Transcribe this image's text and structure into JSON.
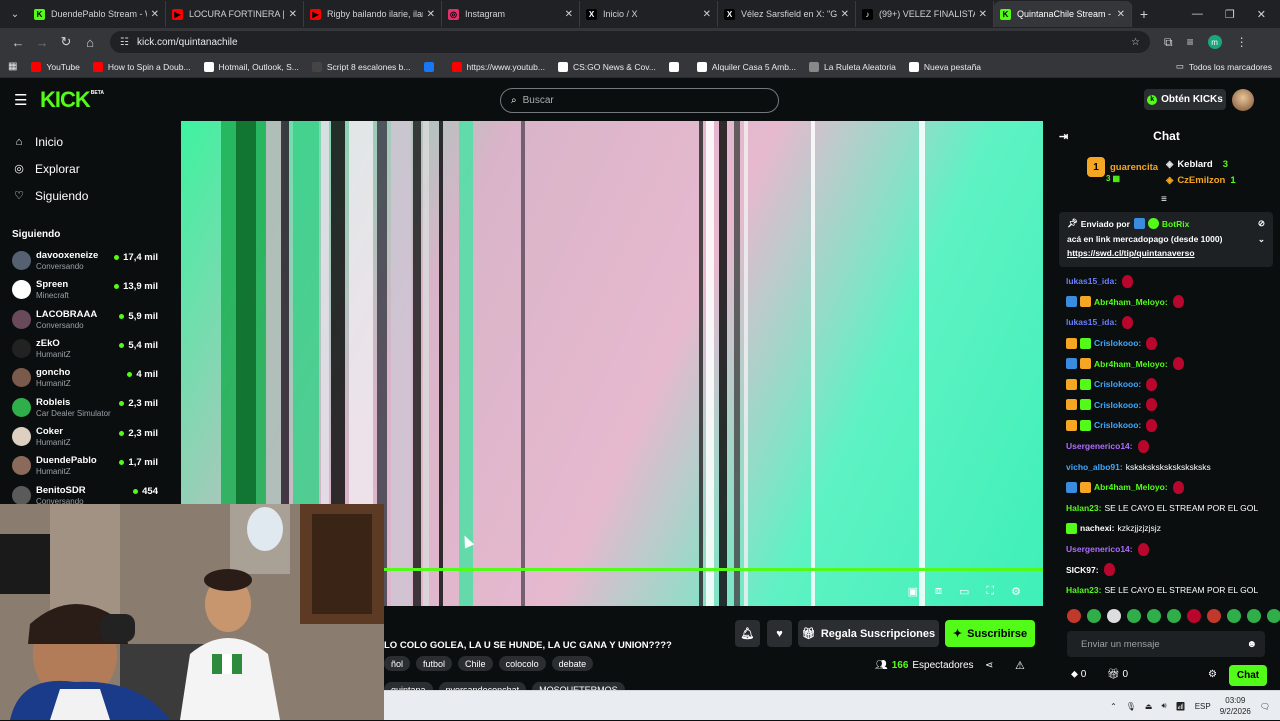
{
  "browser": {
    "tabs": [
      {
        "label": "DuendePablo Stream - W",
        "color": "#53fc18",
        "glyph": "K"
      },
      {
        "label": "LOCURA FORTINERA | VÉL",
        "color": "#ff0000",
        "glyph": "▶"
      },
      {
        "label": "Rigby bailando ilarie, ilari",
        "color": "#ff0000",
        "glyph": "▶"
      },
      {
        "label": "Instagram",
        "color": "#e1306c",
        "glyph": "◎"
      },
      {
        "label": "Inicio / X",
        "color": "#000000",
        "glyph": "X"
      },
      {
        "label": "Vélez Sarsfield en X: \"Gui",
        "color": "#000000",
        "glyph": "X"
      },
      {
        "label": "(99+) VELEZ FINALISTA V",
        "color": "#000000",
        "glyph": "♪"
      },
      {
        "label": "QuintanaChile Stream - W",
        "color": "#53fc18",
        "glyph": "K"
      }
    ],
    "url": "kick.com/quintanachile",
    "bookmarks": [
      {
        "label": "YouTube",
        "color": "#ff0000"
      },
      {
        "label": "How to Spin a Doub...",
        "color": "#ff0000"
      },
      {
        "label": "Hotmail, Outlook, S...",
        "color": "#ffffff"
      },
      {
        "label": "Script 8 escalones b...",
        "color": "#444444"
      },
      {
        "label": "",
        "color": "#1877f2"
      },
      {
        "label": "https://www.youtub...",
        "color": "#ff0000"
      },
      {
        "label": "CS:GO News & Cov...",
        "color": "#ffffff"
      },
      {
        "label": "",
        "color": "#ffffff"
      },
      {
        "label": "Alquiler Casa 5 Amb...",
        "color": "#ffffff"
      },
      {
        "label": "La Ruleta Aleatoria",
        "color": "#888888"
      },
      {
        "label": "Nueva pestaña",
        "color": "#ffffff"
      }
    ],
    "all_bookmarks": "Todos los marcadores"
  },
  "kick": {
    "logo": "KICK",
    "logo_sup": "BETA",
    "search_placeholder": "Buscar",
    "kicks_button": "Obtén KICKs",
    "accent": "#53fc18"
  },
  "sidebar": {
    "nav": [
      {
        "label": "Inicio",
        "icon": "home-icon"
      },
      {
        "label": "Explorar",
        "icon": "compass-icon"
      },
      {
        "label": "Siguiendo",
        "icon": "heart-icon"
      }
    ],
    "section_title": "Siguiendo",
    "following": [
      {
        "name": "davooxeneize",
        "game": "Conversando",
        "viewers": "17,4 mil",
        "avatar": "#556070"
      },
      {
        "name": "Spreen",
        "game": "Minecraft",
        "viewers": "13,9 mil",
        "avatar": "#ffffff"
      },
      {
        "name": "LACOBRAAA",
        "game": "Conversando",
        "viewers": "5,9 mil",
        "avatar": "#6a4a5a"
      },
      {
        "name": "zEkO",
        "game": "HumanitZ",
        "viewers": "5,4 mil",
        "avatar": "#222222"
      },
      {
        "name": "goncho",
        "game": "HumanitZ",
        "viewers": "4 mil",
        "avatar": "#7a5a4a"
      },
      {
        "name": "Robleis",
        "game": "Car Dealer Simulator",
        "viewers": "2,3 mil",
        "avatar": "#2fae4a"
      },
      {
        "name": "Coker",
        "game": "HumanitZ",
        "viewers": "2,3 mil",
        "avatar": "#ddd0c0"
      },
      {
        "name": "DuendePablo",
        "game": "HumanitZ",
        "viewers": "1,7 mil",
        "avatar": "#8a6a5a"
      },
      {
        "name": "BenitoSDR",
        "game": "Conversando",
        "viewers": "454",
        "avatar": "#5a5a5a"
      }
    ]
  },
  "stream": {
    "title": "LO COLO GOLEA, LA U SE HUNDE, LA UC GANA Y UNION????",
    "tags": [
      "ñol",
      "futbol",
      "Chile",
      "colocolo",
      "debate",
      "quintana",
      "nversandoconchat",
      "MOSQUETERMOS"
    ],
    "gift_button": "Regala Suscripciones",
    "subscribe_button": "Suscribirse",
    "viewers_count": "166",
    "viewers_label": "Espectadores",
    "progress": 0.23
  },
  "chat": {
    "title": "Chat",
    "leaderboard": [
      {
        "rank": "1",
        "name": "guarencita",
        "count": "3",
        "color": "#f5a623"
      },
      {
        "name": "Keblard",
        "count": "3",
        "color": "#ffffff"
      },
      {
        "name": "CzEmilzon",
        "count": "1",
        "color": "#f5a623"
      }
    ],
    "pinned_by": "Enviado por",
    "pinned_user": "BotRix",
    "pinned_text": "acá en link mercadopago (desde 1000)",
    "pinned_link": "https://swd.cl/tip/quintanaverso",
    "messages": [
      {
        "user": "lukas15_ida",
        "color": "#6b7fff",
        "text": "",
        "emote": true,
        "badges": []
      },
      {
        "user": "Abr4ham_Meloyo",
        "color": "#53fc18",
        "text": "",
        "emote": true,
        "badges": [
          "#3a8dde",
          "#f5a623"
        ]
      },
      {
        "user": "lukas15_ida",
        "color": "#6b7fff",
        "text": "",
        "emote": true,
        "badges": []
      },
      {
        "user": "Crislokooo",
        "color": "#3fa9ff",
        "text": "",
        "emote": true,
        "badges": [
          "#f5a623",
          "#53fc18"
        ]
      },
      {
        "user": "Abr4ham_Meloyo",
        "color": "#53fc18",
        "text": "",
        "emote": true,
        "badges": [
          "#3a8dde",
          "#f5a623"
        ]
      },
      {
        "user": "Crislokooo",
        "color": "#3fa9ff",
        "text": "",
        "emote": true,
        "badges": [
          "#f5a623",
          "#53fc18"
        ]
      },
      {
        "user": "Crislokooo",
        "color": "#3fa9ff",
        "text": "",
        "emote": true,
        "badges": [
          "#f5a623",
          "#53fc18"
        ]
      },
      {
        "user": "Crislokooo",
        "color": "#3fa9ff",
        "text": "",
        "emote": true,
        "badges": [
          "#f5a623",
          "#53fc18"
        ]
      },
      {
        "user": "Usergenerico14",
        "color": "#b06bff",
        "text": "",
        "emote": true,
        "badges": []
      },
      {
        "user": "vicho_albo91",
        "color": "#3fa9ff",
        "text": "ksksksksksksksksksks",
        "emote": false,
        "badges": []
      },
      {
        "user": "Abr4ham_Meloyo",
        "color": "#53fc18",
        "text": "",
        "emote": true,
        "badges": [
          "#3a8dde",
          "#f5a623"
        ]
      },
      {
        "user": "Halan23",
        "color": "#53fc18",
        "text": "SE LE CAYO EL STREAM POR EL GOL",
        "emote": false,
        "badges": []
      },
      {
        "user": "nachexi",
        "color": "#ffffff",
        "text": "kzkzjjzjzjsjz",
        "emote": false,
        "badges": [
          "#53fc18"
        ]
      },
      {
        "user": "Usergenerico14",
        "color": "#b06bff",
        "text": "",
        "emote": true,
        "badges": []
      },
      {
        "user": "SICK97",
        "color": "#ffffff",
        "text": "",
        "emote": true,
        "badges": []
      },
      {
        "user": "Halan23",
        "color": "#53fc18",
        "text": "SE LE CAYO EL STREAM POR EL GOL",
        "emote": false,
        "badges": []
      }
    ],
    "input_placeholder": "Enviar un mensaje",
    "footer_left": "0",
    "footer_mid": "0",
    "chat_button": "Chat"
  },
  "taskbar": {
    "lang": "ESP",
    "time": "03:09",
    "date": "9/2/2026"
  }
}
